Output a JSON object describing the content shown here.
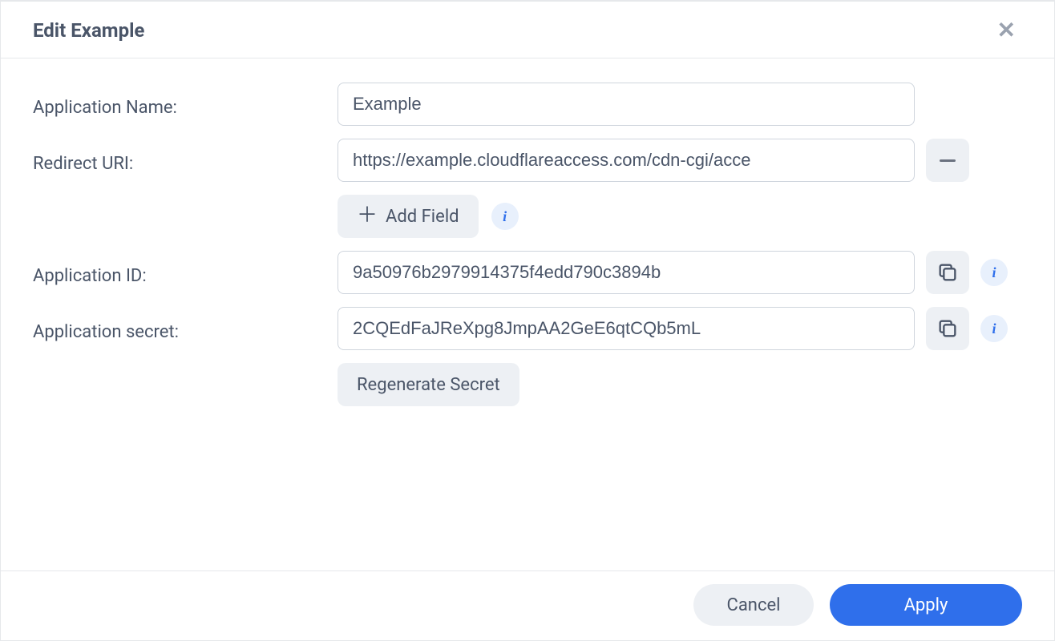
{
  "dialog": {
    "title": "Edit Example",
    "close_glyph": "✕"
  },
  "form": {
    "app_name_label": "Application Name:",
    "app_name_value": "Example",
    "redirect_uri_label": "Redirect URI:",
    "redirect_uri_value": "https://example.cloudflareaccess.com/cdn-cgi/acce",
    "add_field_label": "Add Field",
    "app_id_label": "Application ID:",
    "app_id_value": "9a50976b2979914375f4edd790c3894b",
    "app_secret_label": "Application secret:",
    "app_secret_value": "2CQEdFaJReXpg8JmpAA2GeE6qtCQb5mL",
    "regenerate_label": "Regenerate Secret"
  },
  "footer": {
    "cancel_label": "Cancel",
    "apply_label": "Apply"
  },
  "icons": {
    "info_glyph": "i"
  },
  "colors": {
    "accent": "#2f6feb",
    "muted_bg": "#edf0f4",
    "border": "#cfd5dd",
    "text": "#4a5568"
  }
}
